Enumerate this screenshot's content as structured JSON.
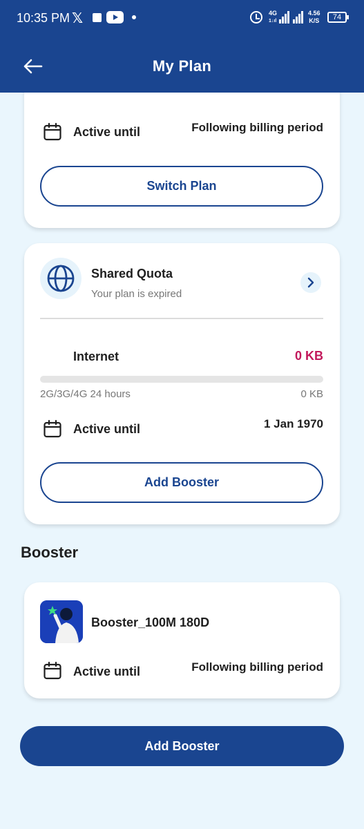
{
  "status_bar": {
    "time": "10:35 PM",
    "x_logo": "𝕏",
    "network": "4G",
    "network_sub": "1↓ıl",
    "speed_top": "4.56",
    "speed_bottom": "K/S",
    "battery": "74"
  },
  "header": {
    "title": "My Plan",
    "back_icon": "arrow-left-icon",
    "background": "#1a4590"
  },
  "plan_card": {
    "active_label": "Active until",
    "active_value": "Following billing period",
    "button_label": "Switch Plan"
  },
  "shared_quota_card": {
    "title": "Shared Quota",
    "subtitle": "Your plan is expired",
    "internet_label": "Internet",
    "internet_value": "0 KB",
    "internet_value_color": "#c2185b",
    "usage_fraction": 0,
    "package_label": "2G/3G/4G 24 hours",
    "package_value": "0 KB",
    "active_label": "Active until",
    "active_value": "1 Jan 1970",
    "button_label": "Add Booster"
  },
  "booster_section": {
    "heading": "Booster",
    "item": {
      "name": "Booster_100M 180D",
      "active_label": "Active until",
      "active_value": "Following billing period"
    }
  },
  "footer": {
    "button_label": "Add Booster"
  },
  "colors": {
    "accent": "#1a4590",
    "page_background": "#eaf6fd",
    "alert": "#c2185b"
  }
}
